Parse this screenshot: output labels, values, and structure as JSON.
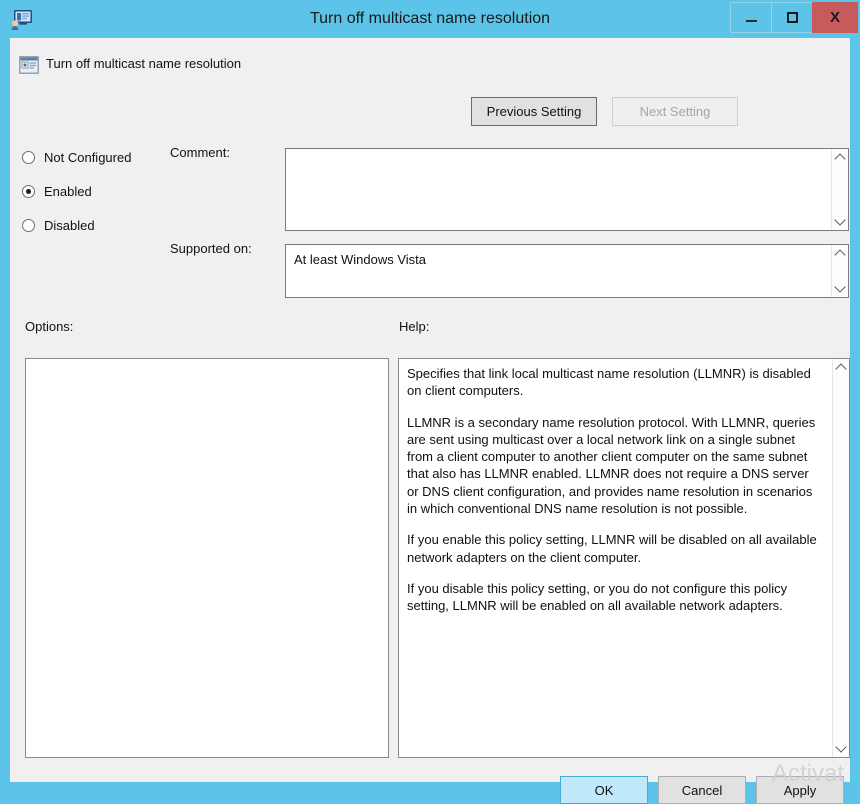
{
  "window": {
    "title": "Turn off multicast name resolution",
    "titlebar_color": "#5bc4e8",
    "icon": "group-policy-editor-icon",
    "buttons": {
      "minimize": "–",
      "maximize": "□",
      "close": "X"
    }
  },
  "header": {
    "setting_icon": "policy-setting-icon",
    "setting_name": "Turn off multicast name resolution",
    "previous_setting_label": "Previous Setting",
    "next_setting_label": "Next Setting",
    "next_setting_enabled": false,
    "previous_setting_enabled": true
  },
  "state_options": [
    {
      "id": "not-configured",
      "label": "Not Configured",
      "selected": false
    },
    {
      "id": "enabled",
      "label": "Enabled",
      "selected": true
    },
    {
      "id": "disabled",
      "label": "Disabled",
      "selected": false
    }
  ],
  "comment": {
    "label": "Comment:",
    "value": ""
  },
  "supported_on": {
    "label": "Supported on:",
    "value": "At least Windows Vista"
  },
  "options": {
    "label": "Options:",
    "value": ""
  },
  "help": {
    "label": "Help:",
    "paragraphs": [
      "Specifies that link local multicast name resolution (LLMNR) is disabled on client computers.",
      "LLMNR is a secondary name resolution protocol. With LLMNR, queries are sent using multicast over a local network link on a single subnet from a client computer to another client computer on the same subnet that also has LLMNR enabled. LLMNR does not require a DNS server or DNS client configuration, and provides name resolution in scenarios in which conventional DNS name resolution is not possible.",
      "If you enable this policy setting, LLMNR will be disabled on all available network adapters on the client computer.",
      "If you disable this policy setting, or you do not configure this policy setting, LLMNR will be enabled on all available network adapters."
    ]
  },
  "footer": {
    "ok_label": "OK",
    "cancel_label": "Cancel",
    "apply_label": "Apply"
  },
  "watermark": {
    "text": "Activat"
  },
  "scrollbar_glyphs": {
    "up": "∧",
    "down": "∨"
  }
}
